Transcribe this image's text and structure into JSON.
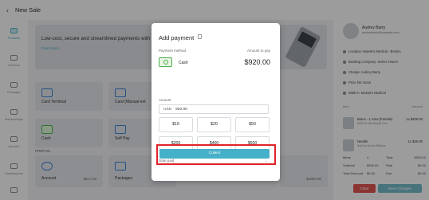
{
  "header": {
    "back_icon": "chevron-left-icon",
    "title": "New Sale"
  },
  "nav": {
    "items": [
      {
        "label": "Products",
        "icon": "products-icon",
        "active": true
      },
      {
        "label": "Services",
        "icon": "services-icon"
      },
      {
        "label": "Packages",
        "icon": "packages-icon"
      },
      {
        "label": "Memberships",
        "icon": "memberships-icon"
      },
      {
        "label": "Account",
        "icon": "account-icon"
      },
      {
        "label": "Commissions",
        "icon": "commissions-icon"
      },
      {
        "label": "",
        "icon": "more-icon"
      }
    ]
  },
  "banner": {
    "text": "Low-cost, secure and streamlined payments with Pabau",
    "link": "Read More"
  },
  "cards": [
    {
      "label": "Card Terminal",
      "icon": "card-terminal-icon"
    },
    {
      "label": "Card (Manual ent",
      "icon": "card-manual-icon"
    },
    {
      "label": "Cash",
      "icon": "cash-icon"
    },
    {
      "label": "Self Pay",
      "icon": "self-pay-icon"
    },
    {
      "label": "Account",
      "icon": "account-icon",
      "value": "$517.00"
    },
    {
      "label": "Packages",
      "icon": "packages-icon"
    }
  ],
  "right_card_value": "$1900.00",
  "section_title": "PREPAID",
  "client": {
    "name": "Audrey Barry",
    "email": "audreybarry@example.com"
  },
  "info": [
    {
      "label": "Location: Maestro Medical - Boston"
    },
    {
      "label": "Booking Company: Select Insurer"
    },
    {
      "label": "Charge: Audrey Barry"
    },
    {
      "label": "Price list: None"
    },
    {
      "label": "Walk in: Maestro Medical"
    }
  ],
  "items_header": {
    "left": "Item",
    "right": "Amount"
  },
  "line_items": [
    {
      "name": "Botox - 1 Area (Female)",
      "desc": "$400.00 with Bhavik Doe",
      "price": "1x $400.00"
    },
    {
      "name": "Needle",
      "desc": "Sold by Simon Williams",
      "price": "1x $20.00"
    }
  ],
  "totals": [
    {
      "l1": "Items",
      "v1": "4",
      "l2": "Total",
      "v2": "$920.00"
    },
    {
      "l1": "Subtotal",
      "v1": "$920.00",
      "l2": "Paid",
      "v2": "$0.00"
    },
    {
      "l1": "Total Discount",
      "v1": "$0.00",
      "l2": "Due",
      "v2": "$0.00"
    }
  ],
  "buttons": {
    "clear": "Clear",
    "save": "Save Changes"
  },
  "modal": {
    "title": "Add payment",
    "copy_icon": "copy-icon",
    "payment_method_label": "Payment method",
    "amount_to_pay_label": "Amount to pay",
    "method": "Cash",
    "amount": "$920.00",
    "amount_label": "Amount",
    "currency": "USD",
    "amount_value": "920.00",
    "quick_amounts": [
      "$10",
      "$20",
      "$50",
      "$200",
      "$400",
      "$500"
    ],
    "date_paid_label": "Date paid",
    "date_chevron": "chevron-down-icon",
    "collect_label": "Collect"
  },
  "colors": {
    "accent": "#45b0c9",
    "highlight": "#e0232b",
    "cash": "#4caf50"
  }
}
